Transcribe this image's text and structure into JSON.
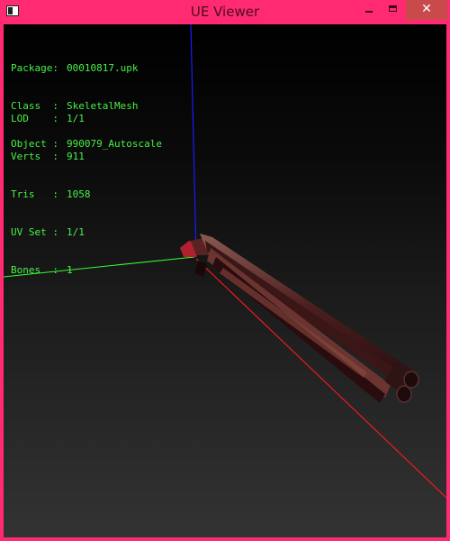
{
  "window": {
    "title": "UE Viewer",
    "close_glyph": "✕"
  },
  "info_block1": [
    {
      "key": "Package:",
      "value": "00010817.upk"
    },
    {
      "key": "Class  :",
      "value": "SkeletalMesh"
    },
    {
      "key": "Object :",
      "value": "990079_Autoscale"
    }
  ],
  "info_block2": [
    {
      "key": "LOD    :",
      "value": "1/1"
    },
    {
      "key": "Verts  :",
      "value": "911"
    },
    {
      "key": "Tris   :",
      "value": "1058"
    },
    {
      "key": "UV Set :",
      "value": "1/1"
    },
    {
      "key": "Bones  :",
      "value": "1"
    }
  ],
  "colors": {
    "accent": "#ff2a72",
    "text": "#48f048",
    "axis_x": "#ff1a1a",
    "axis_y": "#33ff33",
    "axis_z": "#1a1aff",
    "mesh": "#5a2a2a"
  }
}
